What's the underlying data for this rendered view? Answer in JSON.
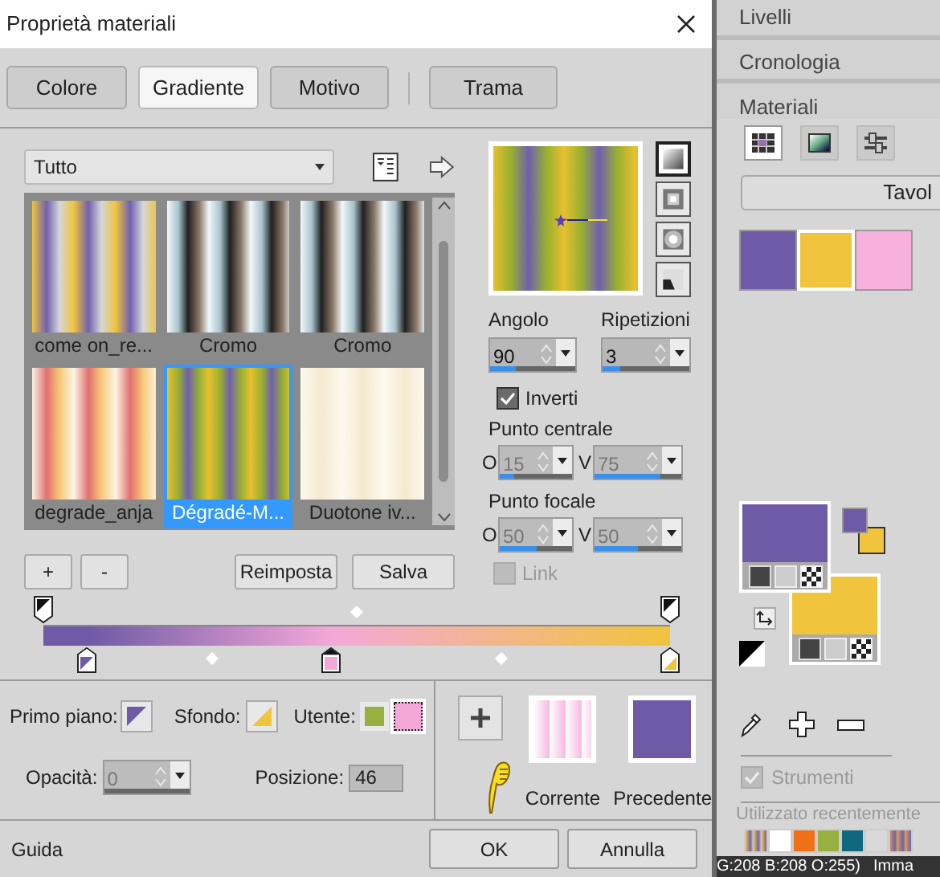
{
  "dialog": {
    "title": "Proprietà materiali"
  },
  "tabs": [
    {
      "label": "Colore",
      "selected": false
    },
    {
      "label": "Gradiente",
      "selected": true
    },
    {
      "label": "Motivo",
      "selected": false
    },
    {
      "label": "Trama",
      "selected": false
    }
  ],
  "category": {
    "value": "Tutto"
  },
  "gradients": [
    {
      "label": "come on_re...",
      "selected": false
    },
    {
      "label": "Cromo",
      "selected": false
    },
    {
      "label": "Cromo",
      "selected": false
    },
    {
      "label": "degrade_anja",
      "selected": false
    },
    {
      "label": "Dégradé-M...",
      "selected": true
    },
    {
      "label": "Duotone iv...",
      "selected": false
    }
  ],
  "styles": [
    {
      "kind": "linear",
      "selected": true
    },
    {
      "kind": "rectangular",
      "selected": false
    },
    {
      "kind": "radial",
      "selected": false
    },
    {
      "kind": "corner",
      "selected": false
    }
  ],
  "angle": {
    "label": "Angolo",
    "value": "90",
    "level": 0.3
  },
  "repeats": {
    "label": "Ripetizioni",
    "value": "3",
    "level": 0.2
  },
  "invert": {
    "label": "Inverti",
    "checked": true
  },
  "center_point": {
    "label": "Punto centrale",
    "fields": [
      {
        "prefix": "O",
        "value": "15",
        "level": 0.2,
        "disabled": true
      },
      {
        "prefix": "V",
        "value": "75",
        "level": 0.75,
        "disabled": true
      }
    ]
  },
  "focal_point": {
    "label": "Punto focale",
    "fields": [
      {
        "prefix": "O",
        "value": "50",
        "level": 0.5,
        "disabled": true
      },
      {
        "prefix": "V",
        "value": "50",
        "level": 0.5,
        "disabled": true
      }
    ]
  },
  "link": {
    "label": "Link",
    "checked": false,
    "disabled": true
  },
  "gallery_buttons": [
    "+",
    "-"
  ],
  "action_buttons": [
    "Reimposta",
    "Salva"
  ],
  "gradient_bar": {
    "color_stops": [
      {
        "kind": "foreground",
        "color": "#6e5aa6",
        "selected": false
      },
      {
        "kind": "user",
        "color": "#f4a8d8",
        "selected": true
      },
      {
        "kind": "background",
        "color": "#f0c43c",
        "selected": false
      }
    ]
  },
  "foreground": {
    "label": "Primo piano:"
  },
  "background": {
    "label": "Sfondo:"
  },
  "user": {
    "label": "Utente:",
    "swatches": [
      {
        "color": "#98b040",
        "selected": false
      },
      {
        "color": "#f4a8d8",
        "selected": true
      }
    ]
  },
  "opacity": {
    "label": "Opacità:",
    "value": "0",
    "disabled": true
  },
  "position": {
    "label": "Posizione:",
    "value": "46"
  },
  "current": {
    "label": "Corrente"
  },
  "previous": {
    "label": "Precedente",
    "color": "#6e5aa6"
  },
  "footer": {
    "help": "Guida",
    "buttons": [
      "OK",
      "Annulla"
    ]
  },
  "panel": {
    "sections": [
      "Livelli",
      "Cronologia",
      "Materiali"
    ],
    "modes": [
      {
        "kind": "swatches",
        "selected": true
      },
      {
        "kind": "spectrum",
        "selected": false
      },
      {
        "kind": "sliders",
        "selected": false
      }
    ],
    "palette_button": "Tavol",
    "swatches": [
      {
        "color": "#6e5aa6",
        "selected": false
      },
      {
        "color": "#f0c43c",
        "selected": true
      },
      {
        "color": "#f8b0dc",
        "selected": false
      }
    ],
    "foreground": {
      "color": "#6e5aa6"
    },
    "background": {
      "color": "#f0c43c"
    },
    "tools_option": {
      "label": "Strumenti",
      "checked": true,
      "disabled": true
    },
    "recent_label": "Utilizzato recentemente",
    "recent": [
      {
        "kind": "pattern"
      },
      {
        "kind": "color",
        "color": "#ffffff"
      },
      {
        "kind": "color",
        "color": "#f07018"
      },
      {
        "kind": "color",
        "color": "#98b040"
      },
      {
        "kind": "color",
        "color": "#106880"
      },
      {
        "kind": "color",
        "color": "#d8d8d8"
      },
      {
        "kind": "pattern"
      }
    ]
  },
  "status_bar": [
    "G:208 B:208 O:255)",
    "Imma"
  ]
}
